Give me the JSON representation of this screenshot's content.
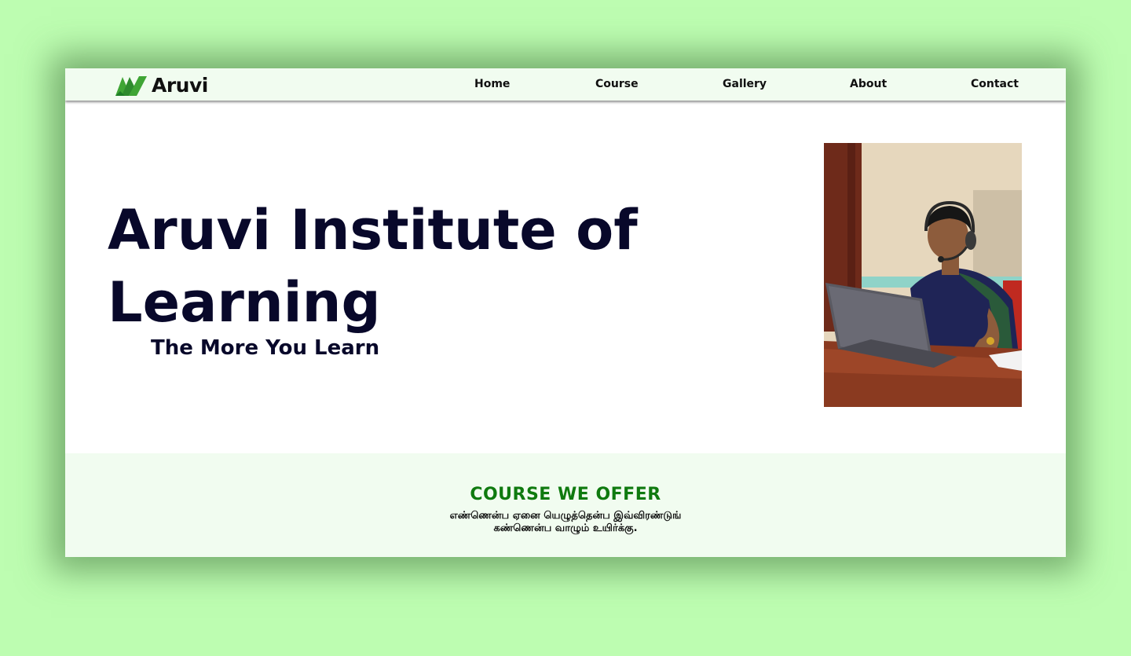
{
  "brand": {
    "name": "Aruvi",
    "logo_icon": "aruvi-mountain-logo",
    "logo_colors": [
      "#3fa535",
      "#1e7e27"
    ]
  },
  "nav": {
    "items": [
      {
        "label": "Home"
      },
      {
        "label": "Course"
      },
      {
        "label": "Gallery"
      },
      {
        "label": "About"
      },
      {
        "label": "Contact"
      }
    ]
  },
  "hero": {
    "title": "Aruvi Institute of Learning",
    "subtitle": "The More You Learn",
    "image": "photo-instructor-with-headset-at-laptop"
  },
  "courses": {
    "title": "COURSE WE OFFER",
    "quote_line_1": "எண்ணென்ப ஏனை யெழுத்தென்ப இவ்விரண்டுங்",
    "quote_line_2": "கண்ணென்ப வாழும் உயிர்க்கு."
  },
  "colors": {
    "page_background": "#bdfdb1",
    "nav_background": "#f1fcf0",
    "heading_text": "#08082a",
    "accent_green": "#0f7a0f"
  }
}
